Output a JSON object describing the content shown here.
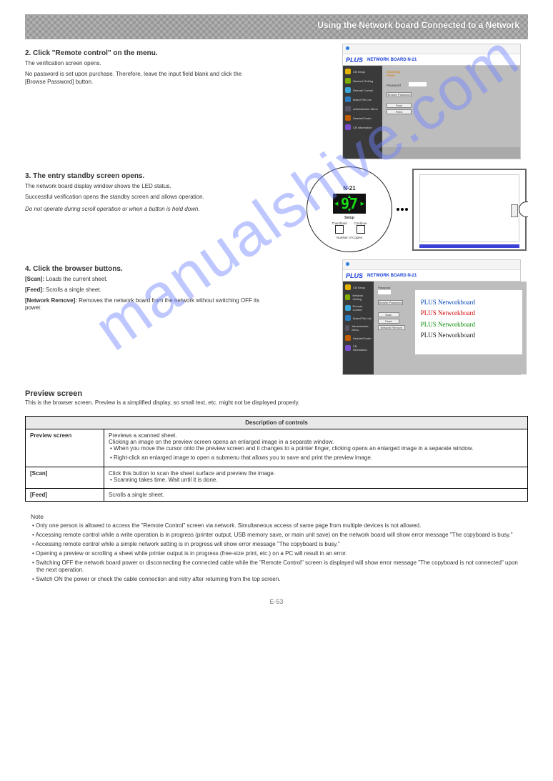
{
  "header_title": "Using the Network board Connected to a Network",
  "watermark": "manualshive.com",
  "page_number": "E-53",
  "step2": {
    "title": "2. Click \"Remote control\" on the menu.",
    "lines": [
      "The verification screen opens.",
      "No password is set upon purchase. Therefore, leave the input field blank and click the [Browse Password] button."
    ]
  },
  "step3": {
    "title": "3. The entry standby screen opens.",
    "lines": [
      "The network board display window shows the LED status.",
      "Successful verification opens the standby screen and allows operation."
    ]
  },
  "caution": "Do not operate during scroll operation or when a button is held down.",
  "step4": {
    "title": "4. Click the browser buttons.",
    "scan_label": "[Scan]:",
    "scan_text": "Loads the current sheet.",
    "feed_label": "[Feed]:",
    "feed_text": "Scrolls a single sheet.",
    "network_label": "[Network Remove]:",
    "network_text": "Removes the network board from the network without switching OFF its power."
  },
  "preview": {
    "title": "Preview screen",
    "intro": "This is the browser screen. Preview is a simplified display, so small text, etc. might not be displayed properly.",
    "table_header": "Description of controls",
    "rows": [
      {
        "label": "Preview screen",
        "lines": [
          "Previews a scanned sheet.",
          "Clicking an image on the preview screen opens an enlarged image in a separate window.",
          "• When you move the cursor onto the preview screen and it changes to a pointer finger, clicking opens an enlarged image in a separate window.",
          "• Right-click an enlarged image to open a submenu that allows you to save and print the preview image."
        ]
      },
      {
        "label": "[Scan]",
        "lines": [
          "Click this button to scan the sheet surface and preview the image.",
          "• Scanning takes time. Wait until it is done."
        ]
      },
      {
        "label": "[Feed]",
        "lines": [
          "Scrolls a single sheet."
        ]
      }
    ]
  },
  "notes": {
    "heading": "Note",
    "items": [
      "• Only one person is allowed to access the \"Remote Control\" screen via network. Simultaneous access of same page from multiple devices is not allowed.",
      "• Accessing remote control while a write operation is in progress (printer output, USB memory save, or main unit save) on the network board will show error message \"The copyboard is busy.\"",
      "• Accessing remote control while a simple network setting is in progress will show error message \"The copyboard is busy.\"",
      "• Opening a preview or scrolling a sheet while printer output is in progress (free-size print, etc.) on a PC will result in an error.",
      "• Switching OFF the network board power or disconnecting the connected cable while the \"Remote Control\" screen is displayed will show error message \"The copyboard is not connected\" upon the next operation.",
      "• Switch ON the power or check the cable connection and retry after returning from the top screen."
    ]
  },
  "browser": {
    "logo": "PLUS",
    "product": "NETWORK BOARD N-21",
    "sidebar": [
      {
        "color": "#e3b200",
        "label": "CB Setup"
      },
      {
        "color": "#7fae00",
        "label": "Network Setting"
      },
      {
        "color": "#3aa6d9",
        "label": "Remote Control"
      },
      {
        "color": "#2b7bbf",
        "label": "Board File List"
      },
      {
        "color": "#556",
        "label": "Administrator Menu"
      },
      {
        "color": "#c25d00",
        "label": "Header/Footer"
      },
      {
        "color": "#7a4fcf",
        "label": "CB Information"
      }
    ],
    "panel1": {
      "section_label": "Scanning Panel",
      "pass_label": "Password",
      "btn_browse": "Browse Password",
      "btn_scan": "Scan",
      "btn_feed": "Feed"
    },
    "panel2": {
      "btn_scan": "Scan",
      "btn_feed": "Feed",
      "btn_network": "Network Remove"
    },
    "hand_lines": [
      "PLUS  Networkboard",
      "PLUS  Networkboard",
      "PLUS  Networkboard",
      "PLUS  Networkboard"
    ]
  },
  "device": {
    "model": "N-21",
    "lcd_value": "97",
    "setup": "Setup",
    "thumb": "Thumbnail",
    "cont": "Continue",
    "copies": "Number of Copies"
  }
}
